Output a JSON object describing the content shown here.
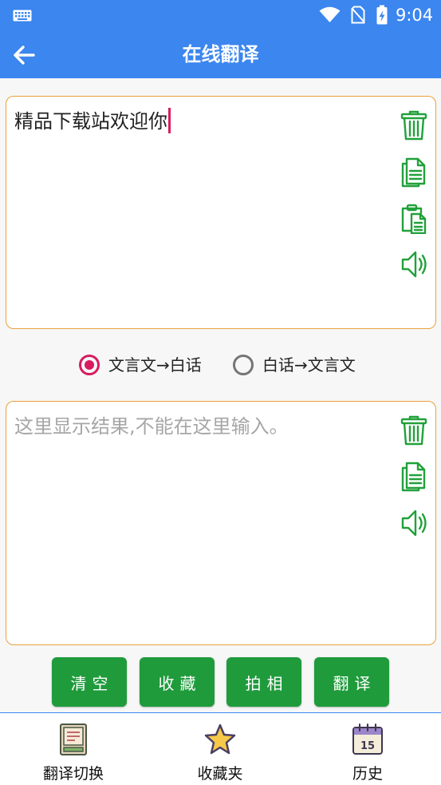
{
  "status_bar": {
    "time": "9:04",
    "icons": [
      "keyboard-icon",
      "wifi-icon",
      "no-sim-icon",
      "battery-charging-icon"
    ]
  },
  "header": {
    "title": "在线翻译",
    "back_icon": "arrow-left-icon"
  },
  "input": {
    "text": "精品下载站欢迎你",
    "tools": [
      "trash-icon",
      "copy-icon",
      "paste-icon",
      "speaker-icon"
    ]
  },
  "modes": [
    {
      "label": "文言文→白话",
      "selected": true
    },
    {
      "label": "白话→文言文",
      "selected": false
    }
  ],
  "output": {
    "placeholder": "这里显示结果,不能在这里输入。",
    "tools": [
      "trash-icon",
      "copy-icon",
      "speaker-icon"
    ]
  },
  "actions": {
    "clear": "清空",
    "favorite": "收藏",
    "photo": "拍相",
    "translate": "翻译"
  },
  "bottom_nav": [
    {
      "label": "翻译切换",
      "icon": "book-icon"
    },
    {
      "label": "收藏夹",
      "icon": "star-icon"
    },
    {
      "label": "历史",
      "icon": "calendar-icon",
      "icon_text": "15"
    }
  ],
  "colors": {
    "primary": "#3b86ef",
    "box_border": "#e9a23b",
    "tool_icon": "#21a13a",
    "button": "#1f9b3c",
    "radio_selected": "#d81b60",
    "placeholder": "#a6a6a6"
  }
}
